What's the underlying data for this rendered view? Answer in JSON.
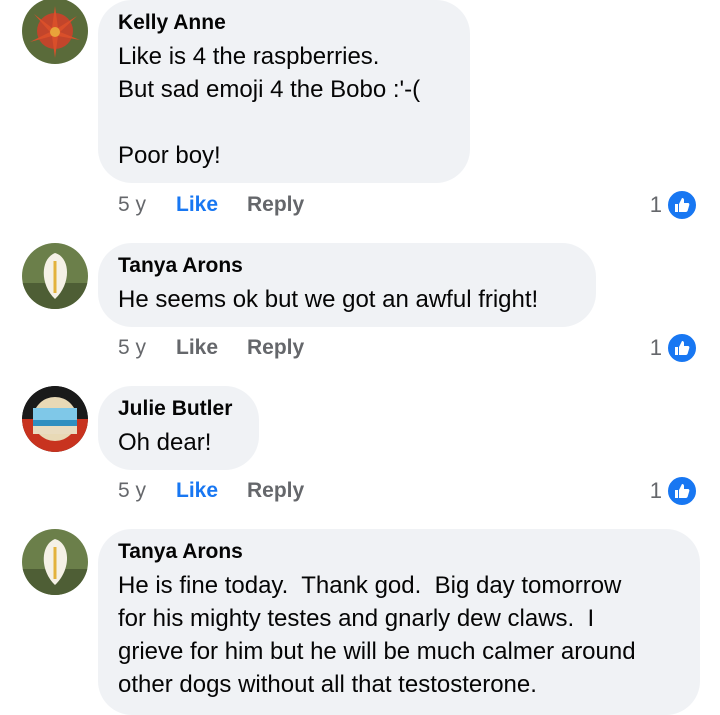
{
  "comments": [
    {
      "author": "Kelly Anne",
      "text": "Like is 4 the raspberries.\nBut sad emoji 4 the Bobo :'-(\n\nPoor boy!",
      "time": "5 y",
      "like_label": "Like",
      "reply_label": "Reply",
      "liked": true,
      "reaction_count": "1"
    },
    {
      "author": "Tanya Arons",
      "text": "He seems ok but we got an awful fright!",
      "time": "5 y",
      "like_label": "Like",
      "reply_label": "Reply",
      "liked": false,
      "reaction_count": "1"
    },
    {
      "author": "Julie Butler",
      "text": "Oh dear!",
      "time": "5 y",
      "like_label": "Like",
      "reply_label": "Reply",
      "liked": true,
      "reaction_count": "1"
    },
    {
      "author": "Tanya Arons",
      "text": "He is fine today.  Thank god.  Big day tomorrow\nfor his mighty testes and gnarly dew claws.  I\ngrieve for him but he will be much calmer around\nother dogs without all that testosterone."
    }
  ],
  "colors": {
    "accent": "#1877f2",
    "bubble": "#f0f2f5",
    "muted": "#65676b"
  }
}
